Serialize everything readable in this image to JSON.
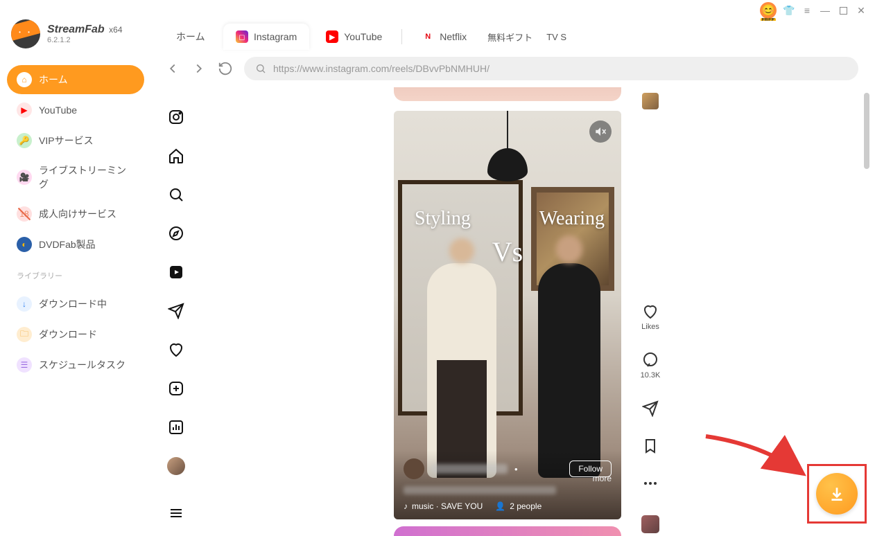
{
  "app": {
    "name": "StreamFab",
    "arch": "x64",
    "version": "6.2.1.2",
    "free_badge": true
  },
  "titlebar": {
    "icons": [
      "tshirt",
      "menu",
      "minimize",
      "maximize",
      "close"
    ]
  },
  "sidebar": {
    "items": [
      {
        "label": "ホーム",
        "icon": "home",
        "active": true
      },
      {
        "label": "YouTube",
        "icon": "youtube"
      },
      {
        "label": "VIPサービス",
        "icon": "vip"
      },
      {
        "label": "ライブストリーミング",
        "icon": "live"
      },
      {
        "label": "成人向けサービス",
        "icon": "adult"
      },
      {
        "label": "DVDFab製品",
        "icon": "dvdfab"
      }
    ],
    "library_header": "ライブラリー",
    "library": [
      {
        "label": "ダウンロード中",
        "icon": "downloading"
      },
      {
        "label": "ダウンロード",
        "icon": "folder"
      },
      {
        "label": "スケジュールタスク",
        "icon": "schedule"
      }
    ]
  },
  "tabs": {
    "items": [
      {
        "label": "ホーム",
        "icon": null
      },
      {
        "label": "Instagram",
        "icon": "instagram",
        "active": true
      },
      {
        "label": "YouTube",
        "icon": "youtube"
      },
      {
        "label": "Netflix",
        "icon": "netflix"
      }
    ],
    "extra": "無料ギフト",
    "extra2": "TV S"
  },
  "toolbar": {
    "url": "https://www.instagram.com/reels/DBvvPbNMHUH/"
  },
  "ig_rail": [
    "logo",
    "home",
    "search",
    "explore",
    "reels",
    "messages",
    "likes",
    "create",
    "insights",
    "avatar",
    "menu"
  ],
  "reel": {
    "overlay": {
      "styling": "Styling",
      "vs": "Vs",
      "wearing": "Wearing"
    },
    "follow": "Follow",
    "more": "more",
    "music_label": "music · SAVE YOU",
    "people_label": "2 people"
  },
  "actions": {
    "likes_label": "Likes",
    "comments_count": "10.3K"
  }
}
